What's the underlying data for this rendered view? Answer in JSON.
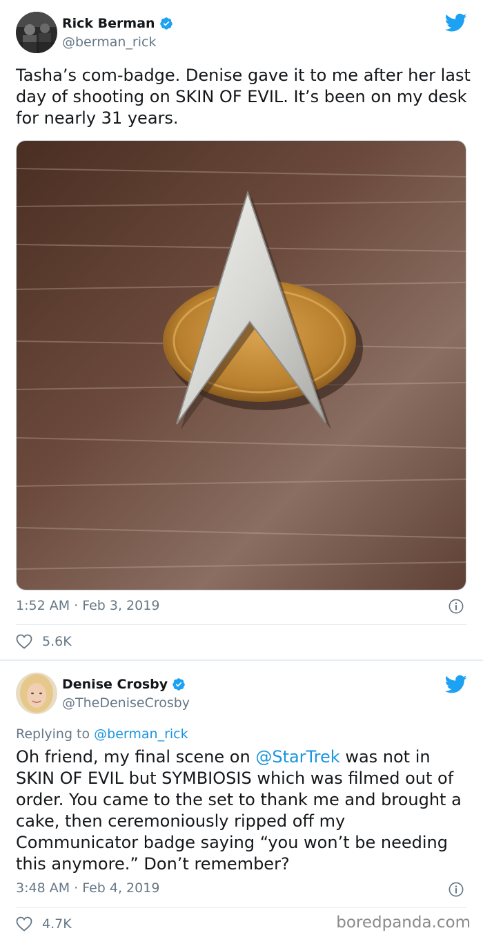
{
  "tweet1": {
    "author_name": "Rick Berman",
    "author_handle": "@berman_rick",
    "text": "Tasha’s com-badge.  Denise gave it to me after her last day of shooting on SKIN OF EVIL.  It’s been on my desk for nearly 31 years.",
    "timestamp": "1:52 AM · Feb 3, 2019",
    "likes": "5.6K"
  },
  "tweet2": {
    "author_name": "Denise Crosby",
    "author_handle": "@TheDeniseCrosby",
    "replying_to_label": "Replying to ",
    "replying_to_handle": "@berman_rick",
    "text_before_mention": "Oh friend, my final scene on ",
    "mention": "@StarTrek",
    "text_after_mention": " was not in SKIN OF EVIL but SYMBIOSIS which was filmed out of order. You came to the set to thank me and brought a cake, then ceremoniously ripped off my Communicator badge saying “you won’t be needing this anymore.” Don’t remember?",
    "timestamp": "3:48 AM · Feb 4, 2019",
    "likes": "4.7K"
  },
  "watermark": "boredpanda.com",
  "colors": {
    "twitter_blue": "#1da1f2",
    "link_blue": "#1b95e0",
    "secondary_text": "#657786"
  },
  "icons": {
    "verified": "verified-badge-icon",
    "bird": "twitter-bird-icon",
    "info": "info-icon",
    "heart": "heart-icon"
  }
}
